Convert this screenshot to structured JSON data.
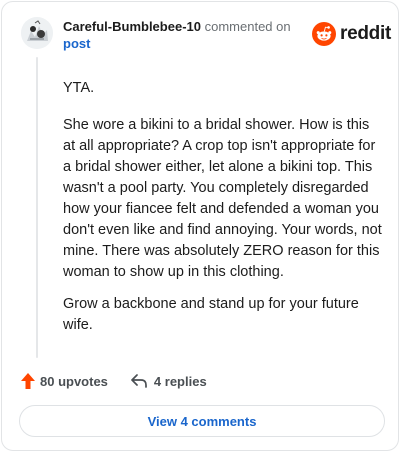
{
  "comment": {
    "author": "Careful-Bumblebee-10",
    "commented_on_text": "commented on",
    "post_link": "post",
    "paragraphs": [
      "YTA.",
      "She wore a bikini to a bridal shower. How is this at all appropriate? A crop top isn't appropriate for a bridal shower either, let alone a bikini top. This wasn't a pool party. You completely disregarded how your fiancee felt and defended a woman you don't even like and find annoying. Your words, not mine. There was absolutely ZERO reason for this woman to show up in this clothing.",
      "Grow a backbone and stand up for your future wife."
    ],
    "upvotes_label": "80 upvotes",
    "replies_label": "4 replies",
    "view_comments_label": "View 4 comments"
  },
  "brand": {
    "name": "reddit",
    "color": "#ff4500"
  },
  "colors": {
    "link": "#1a66cc",
    "upvote": "#ff4500",
    "muted": "#6a6f73"
  },
  "icons": {
    "avatar": "avatar-icon",
    "logo": "reddit-logo-icon",
    "upvote": "upvote-arrow-icon",
    "reply": "reply-arrow-icon"
  }
}
